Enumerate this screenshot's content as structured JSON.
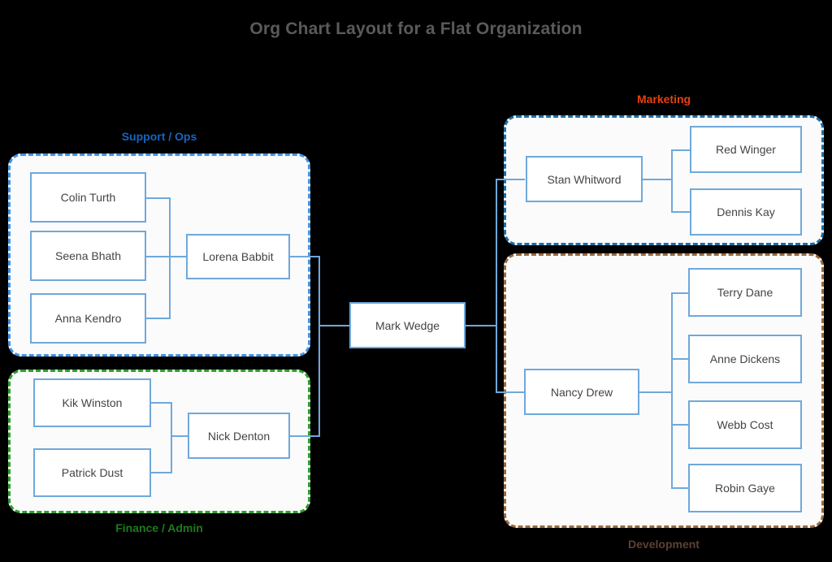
{
  "title": "Org Chart Layout for a Flat Organization",
  "colors": {
    "background": "#000000",
    "title_text": "#5a5a5a",
    "node_border": "#6fa8dc",
    "node_fill": "#ffffff",
    "node_text": "#444444",
    "connector": "#6fa8dc",
    "group_fill": "#fbfbfb",
    "support_border": "#3f94e8",
    "support_label": "#1565c0",
    "finance_border": "#2aa02a",
    "finance_label": "#1f7a1f",
    "marketing_border": "#1b6fa8",
    "marketing_label": "#e8400c",
    "development_border": "#9a6a3c",
    "development_label": "#5c4033"
  },
  "root": {
    "name": "Mark Wedge"
  },
  "groups": {
    "support": {
      "label": "Support / Ops",
      "label_position": "above",
      "lead": "Lorena Babbit",
      "members": [
        "Colin Turth",
        "Seena Bhath",
        "Anna Kendro"
      ]
    },
    "finance": {
      "label": "Finance / Admin",
      "label_position": "below",
      "lead": "Nick Denton",
      "members": [
        "Kik Winston",
        "Patrick Dust"
      ]
    },
    "marketing": {
      "label": "Marketing",
      "label_position": "above",
      "lead": "Stan Whitword",
      "members": [
        "Red Winger",
        "Dennis Kay"
      ]
    },
    "development": {
      "label": "Development",
      "label_position": "below",
      "lead": "Nancy Drew",
      "members": [
        "Terry Dane",
        "Anne Dickens",
        "Webb Cost",
        "Robin Gaye"
      ]
    }
  },
  "chart_data": {
    "type": "diagram",
    "diagram_type": "org-chart",
    "title": "Org Chart Layout for a Flat Organization",
    "nodes": [
      {
        "id": "mark",
        "label": "Mark Wedge",
        "level": 0,
        "group": null
      },
      {
        "id": "lorena",
        "label": "Lorena Babbit",
        "level": 1,
        "group": "Support / Ops"
      },
      {
        "id": "colin",
        "label": "Colin Turth",
        "level": 2,
        "group": "Support / Ops"
      },
      {
        "id": "seena",
        "label": "Seena Bhath",
        "level": 2,
        "group": "Support / Ops"
      },
      {
        "id": "anna",
        "label": "Anna Kendro",
        "level": 2,
        "group": "Support / Ops"
      },
      {
        "id": "nick",
        "label": "Nick Denton",
        "level": 1,
        "group": "Finance / Admin"
      },
      {
        "id": "kik",
        "label": "Kik Winston",
        "level": 2,
        "group": "Finance / Admin"
      },
      {
        "id": "patrick",
        "label": "Patrick Dust",
        "level": 2,
        "group": "Finance / Admin"
      },
      {
        "id": "stan",
        "label": "Stan Whitword",
        "level": 1,
        "group": "Marketing"
      },
      {
        "id": "red",
        "label": "Red Winger",
        "level": 2,
        "group": "Marketing"
      },
      {
        "id": "dennis",
        "label": "Dennis Kay",
        "level": 2,
        "group": "Marketing"
      },
      {
        "id": "nancy",
        "label": "Nancy Drew",
        "level": 1,
        "group": "Development"
      },
      {
        "id": "terry",
        "label": "Terry Dane",
        "level": 2,
        "group": "Development"
      },
      {
        "id": "anne",
        "label": "Anne Dickens",
        "level": 2,
        "group": "Development"
      },
      {
        "id": "webb",
        "label": "Webb Cost",
        "level": 2,
        "group": "Development"
      },
      {
        "id": "robin",
        "label": "Robin Gaye",
        "level": 2,
        "group": "Development"
      }
    ],
    "edges": [
      {
        "from": "mark",
        "to": "lorena"
      },
      {
        "from": "mark",
        "to": "nick"
      },
      {
        "from": "mark",
        "to": "stan"
      },
      {
        "from": "mark",
        "to": "nancy"
      },
      {
        "from": "lorena",
        "to": "colin"
      },
      {
        "from": "lorena",
        "to": "seena"
      },
      {
        "from": "lorena",
        "to": "anna"
      },
      {
        "from": "nick",
        "to": "kik"
      },
      {
        "from": "nick",
        "to": "patrick"
      },
      {
        "from": "stan",
        "to": "red"
      },
      {
        "from": "stan",
        "to": "dennis"
      },
      {
        "from": "nancy",
        "to": "terry"
      },
      {
        "from": "nancy",
        "to": "anne"
      },
      {
        "from": "nancy",
        "to": "webb"
      },
      {
        "from": "nancy",
        "to": "robin"
      }
    ],
    "group_clusters": [
      {
        "label": "Support / Ops",
        "border_color": "#3f94e8",
        "label_color": "#1565c0",
        "members": [
          "Lorena Babbit",
          "Colin Turth",
          "Seena Bhath",
          "Anna Kendro"
        ]
      },
      {
        "label": "Finance / Admin",
        "border_color": "#2aa02a",
        "label_color": "#1f7a1f",
        "members": [
          "Nick Denton",
          "Kik Winston",
          "Patrick Dust"
        ]
      },
      {
        "label": "Marketing",
        "border_color": "#1b6fa8",
        "label_color": "#e8400c",
        "members": [
          "Stan Whitword",
          "Red Winger",
          "Dennis Kay"
        ]
      },
      {
        "label": "Development",
        "border_color": "#9a6a3c",
        "label_color": "#5c4033",
        "members": [
          "Nancy Drew",
          "Terry Dane",
          "Anne Dickens",
          "Webb Cost",
          "Robin Gaye"
        ]
      }
    ]
  }
}
